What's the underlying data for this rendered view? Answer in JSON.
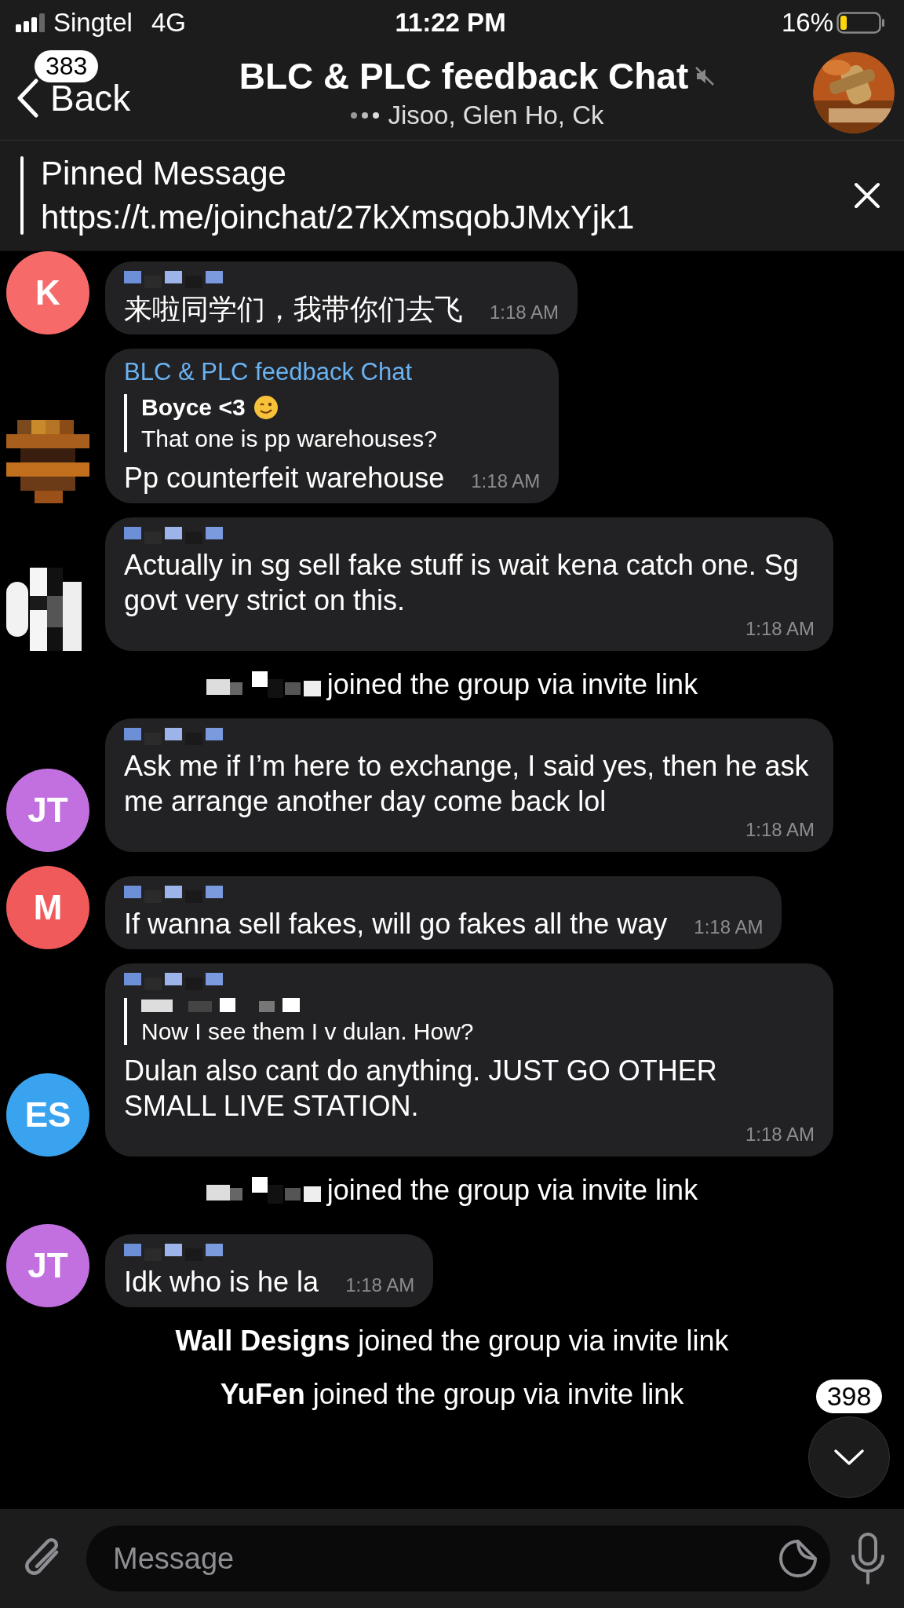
{
  "status_bar": {
    "carrier": "Singtel",
    "network": "4G",
    "time": "11:22 PM",
    "battery": "16%"
  },
  "header": {
    "back_label": "Back",
    "unread_badge": "383",
    "title": "BLC & PLC feedback Chat",
    "muted": true,
    "typing": true,
    "subtitle": "Jisoo, Glen Ho, Ck"
  },
  "pinned": {
    "label": "Pinned Message",
    "text": "https://t.me/joinchat/27kXmsqobJMxYjk1"
  },
  "messages": [
    {
      "kind": "message",
      "avatar": {
        "kind": "initials",
        "initials": "K",
        "color": "#f66a6a"
      },
      "sender_redacted": true,
      "text": "来啦同学们，我带你们去飞",
      "time": "1:18 AM"
    },
    {
      "kind": "message",
      "sender": "BLC & PLC feedback Chat",
      "reply": {
        "author": "Boyce <3",
        "emoji": true,
        "text": "That one is pp warehouses?"
      },
      "text": "Pp counterfeit warehouse",
      "time": "1:18 AM"
    },
    {
      "kind": "message",
      "sender_redacted": true,
      "text": "Actually in sg sell fake stuff is wait kena catch one. Sg govt very strict on this.",
      "time": "1:18 AM"
    },
    {
      "kind": "service",
      "redacted": true,
      "text": "joined the group via invite link"
    },
    {
      "kind": "message",
      "avatar": {
        "kind": "initials",
        "initials": "JT",
        "color": "#c26fe0"
      },
      "sender_redacted": true,
      "text": "Ask me if I’m here to exchange, I said yes, then he ask me arrange another day come back lol",
      "time": "1:18 AM"
    },
    {
      "kind": "message",
      "avatar": {
        "kind": "initials",
        "initials": "M",
        "color": "#f05a5a"
      },
      "sender_redacted": true,
      "text": "If wanna sell fakes, will go fakes all the way",
      "time": "1:18 AM"
    },
    {
      "kind": "message",
      "avatar": {
        "kind": "initials",
        "initials": "ES",
        "color": "#3aa3ef"
      },
      "sender_redacted": true,
      "reply": {
        "author_redacted": true,
        "text": "Now I see them I v dulan. How?"
      },
      "text": "Dulan also cant do anything. JUST GO OTHER SMALL LIVE STATION.",
      "time": "1:18 AM"
    },
    {
      "kind": "service",
      "redacted": true,
      "text": "joined the group via invite link"
    },
    {
      "kind": "message",
      "avatar": {
        "kind": "initials",
        "initials": "JT",
        "color": "#c26fe0"
      },
      "sender_redacted": true,
      "text": "Idk who is he la",
      "time": "1:18 AM"
    },
    {
      "kind": "service",
      "redacted": false,
      "text": "**Wall Designs** joined the group via invite link"
    },
    {
      "kind": "service",
      "redacted": false,
      "text": "**YuFen** joined the group via invite link"
    }
  ],
  "scroll_down": {
    "badge": "398"
  },
  "composer": {
    "placeholder": "Message"
  }
}
